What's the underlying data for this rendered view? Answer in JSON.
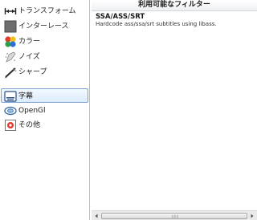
{
  "sidebar": {
    "items": [
      {
        "label": "トランスフォーム",
        "icon": "transform-icon"
      },
      {
        "label": "インターレース",
        "icon": "interlace-icon"
      },
      {
        "label": "カラー",
        "icon": "color-icon"
      },
      {
        "label": "ノイズ",
        "icon": "noise-icon"
      },
      {
        "label": "シャープ",
        "icon": "sharpen-icon"
      },
      {
        "label": "字幕",
        "icon": "subtitle-icon",
        "selected": true
      },
      {
        "label": "OpenGl",
        "icon": "opengl-icon"
      },
      {
        "label": "その他",
        "icon": "misc-icon"
      }
    ]
  },
  "panel": {
    "header": "利用可能なフィルター",
    "filters": [
      {
        "name": "SSA/ASS/SRT",
        "description": "Hardcode ass/ssa/srt subtitles using libass."
      }
    ]
  },
  "colors": {
    "selection_border": "#7da2ce",
    "selection_fill": "#dcebfc"
  }
}
